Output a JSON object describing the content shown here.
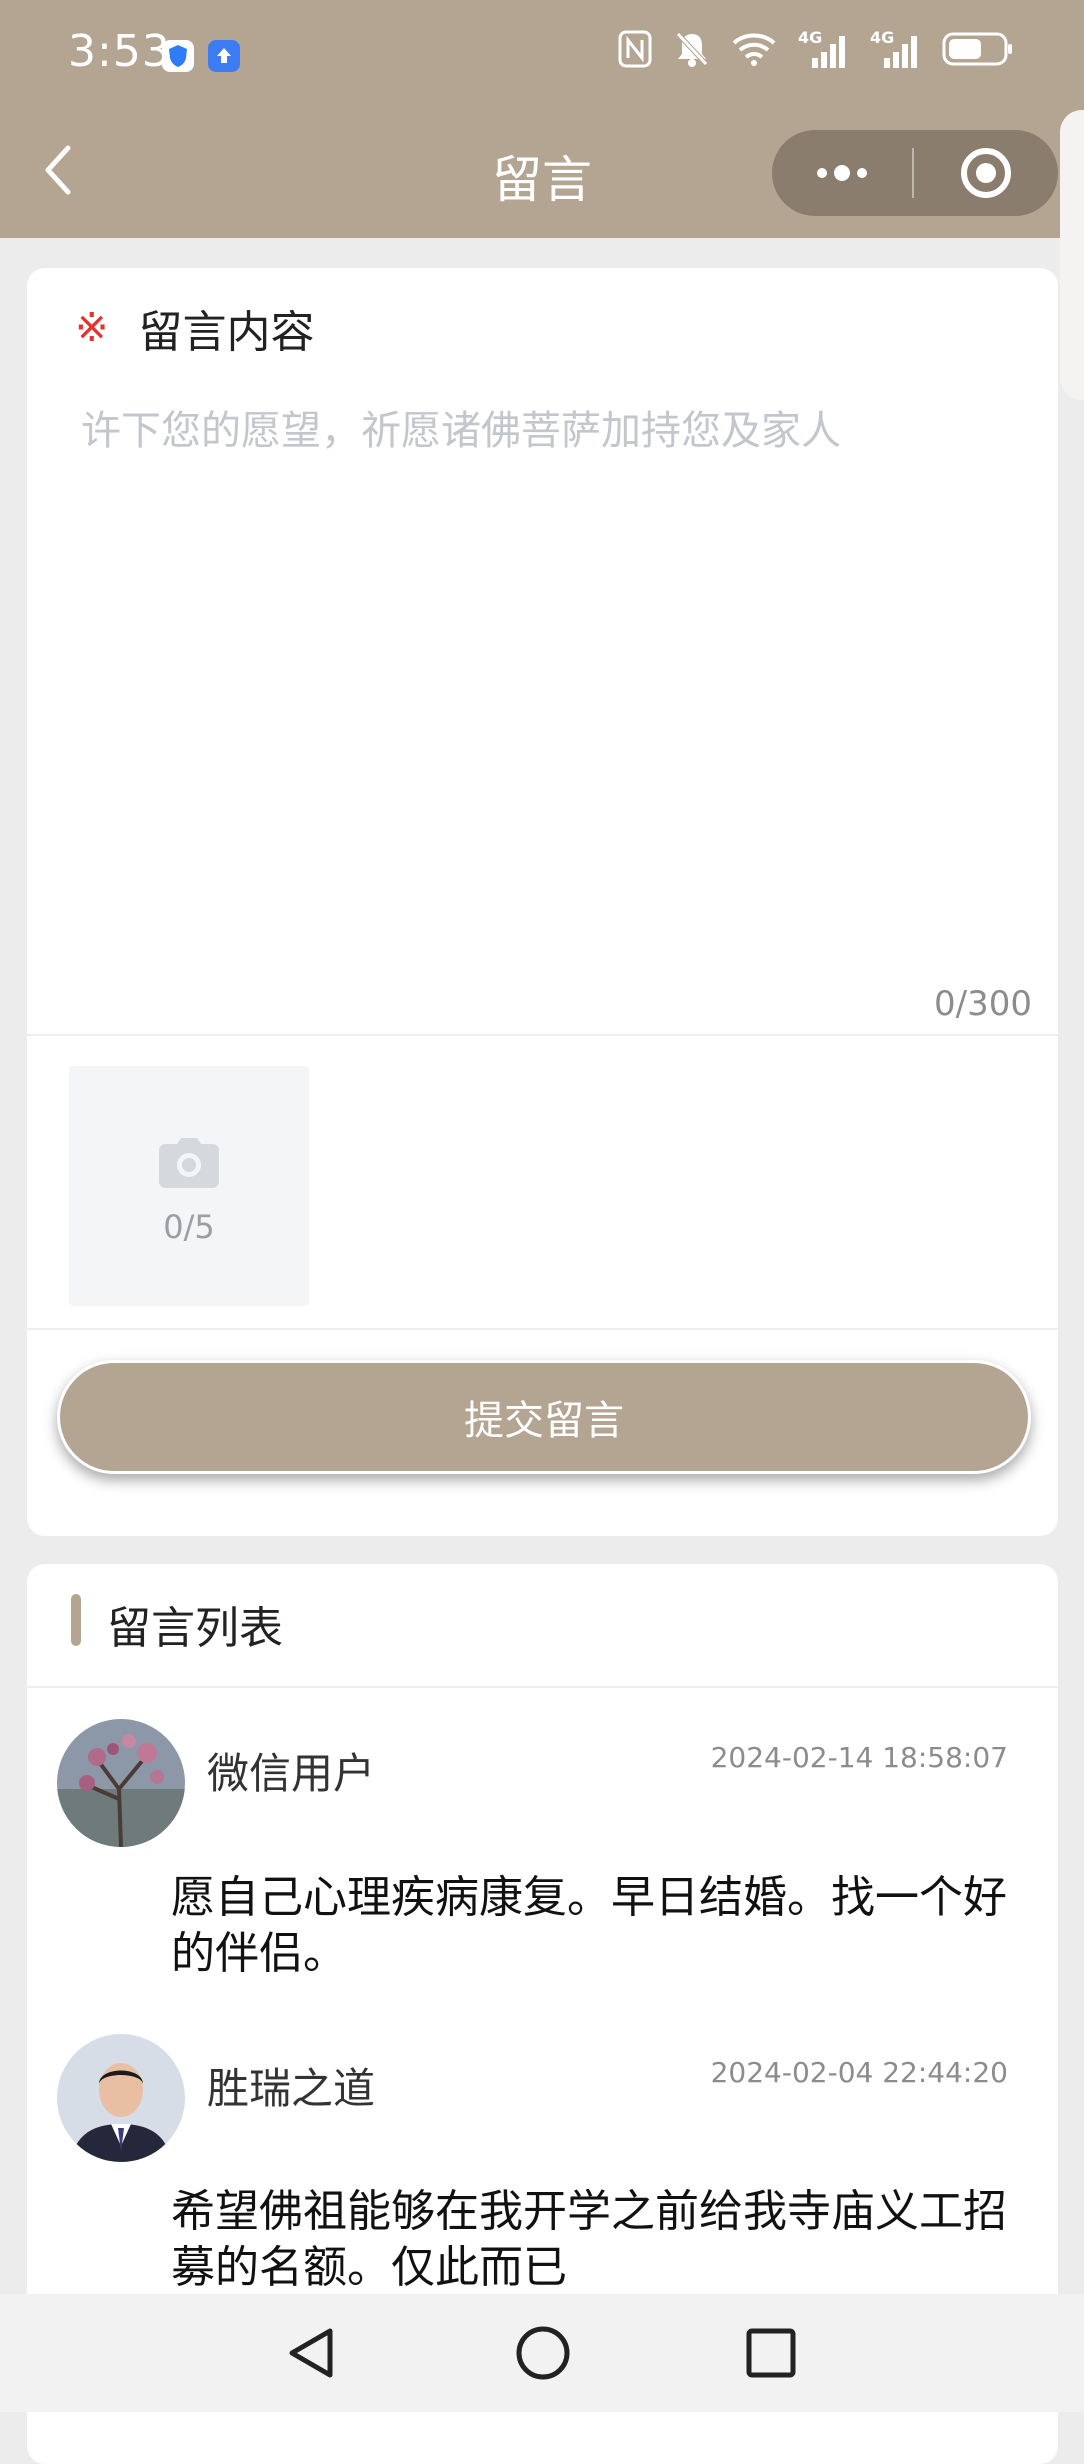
{
  "status_bar": {
    "time": "3:53",
    "icons": [
      "shield-app-icon",
      "upload-app-icon",
      "nfc-icon",
      "mute-icon",
      "wifi-icon",
      "signal-4g-icon",
      "signal-4g-icon",
      "battery-icon"
    ],
    "network_label_1": "4G",
    "network_label_2": "4G"
  },
  "nav": {
    "title": "留言",
    "back_icon": "chevron-left-icon",
    "more_icon": "more-dots-icon",
    "close_icon": "target-close-icon"
  },
  "form": {
    "required_mark": "※",
    "label": "留言内容",
    "placeholder": "许下您的愿望，祈愿诸佛菩萨加持您及家人",
    "counter": "0/300",
    "upload_count": "0/5",
    "upload_icon": "camera-icon",
    "submit_label": "提交留言"
  },
  "list": {
    "title": "留言列表",
    "messages": [
      {
        "name": "微信用户",
        "time": "2024-02-14 18:58:07",
        "content": "愿自己心理疾病康复。早日结婚。找一个好的伴侣。"
      },
      {
        "name": "胜瑞之道",
        "time": "2024-02-04 22:44:20",
        "content": "希望佛祖能够在我开学之前给我寺庙义工招募的名额。仅此而已"
      }
    ]
  },
  "colors": {
    "header": "#b4a593",
    "accent": "#b3a592",
    "required": "#e2342c",
    "page_bg": "#ececec"
  }
}
